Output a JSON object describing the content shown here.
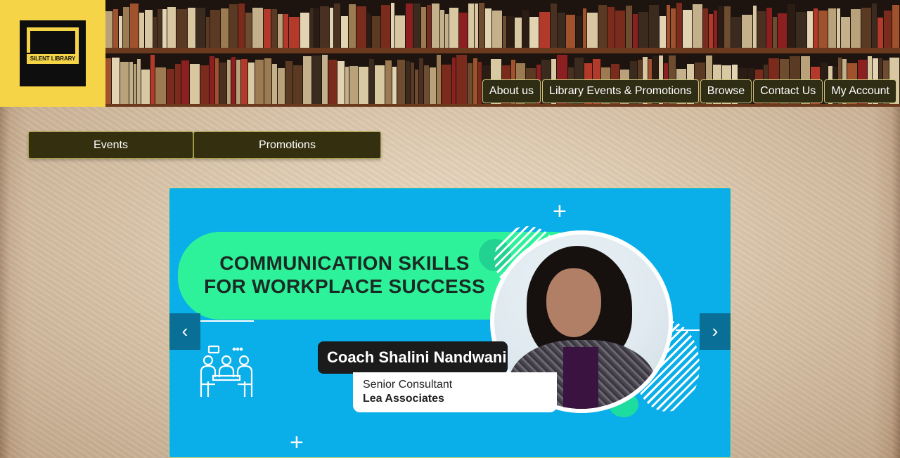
{
  "brand": {
    "logo_text": "SILENT LIBRARY",
    "logo_color": "#f5d547"
  },
  "nav": {
    "items": [
      {
        "label": "About us"
      },
      {
        "label": "Library Events & Promotions"
      },
      {
        "label": "Browse"
      },
      {
        "label": "Contact Us"
      },
      {
        "label": "My Account"
      }
    ]
  },
  "tabs": {
    "events": "Events",
    "promotions": "Promotions"
  },
  "carousel": {
    "slide": {
      "headline_line1": "COMMUNICATION SKILLS",
      "headline_line2": "FOR WORKPLACE SUCCESS",
      "speaker_name": "Coach Shalini Nandwani",
      "speaker_role": "Senior Consultant",
      "speaker_company": "Lea Associates"
    },
    "prev_icon": "chevron-left-icon",
    "next_icon": "chevron-right-icon",
    "prev_glyph": "‹",
    "next_glyph": "›",
    "background_color": "#0aaee8",
    "accent_color": "#2ef29a"
  }
}
